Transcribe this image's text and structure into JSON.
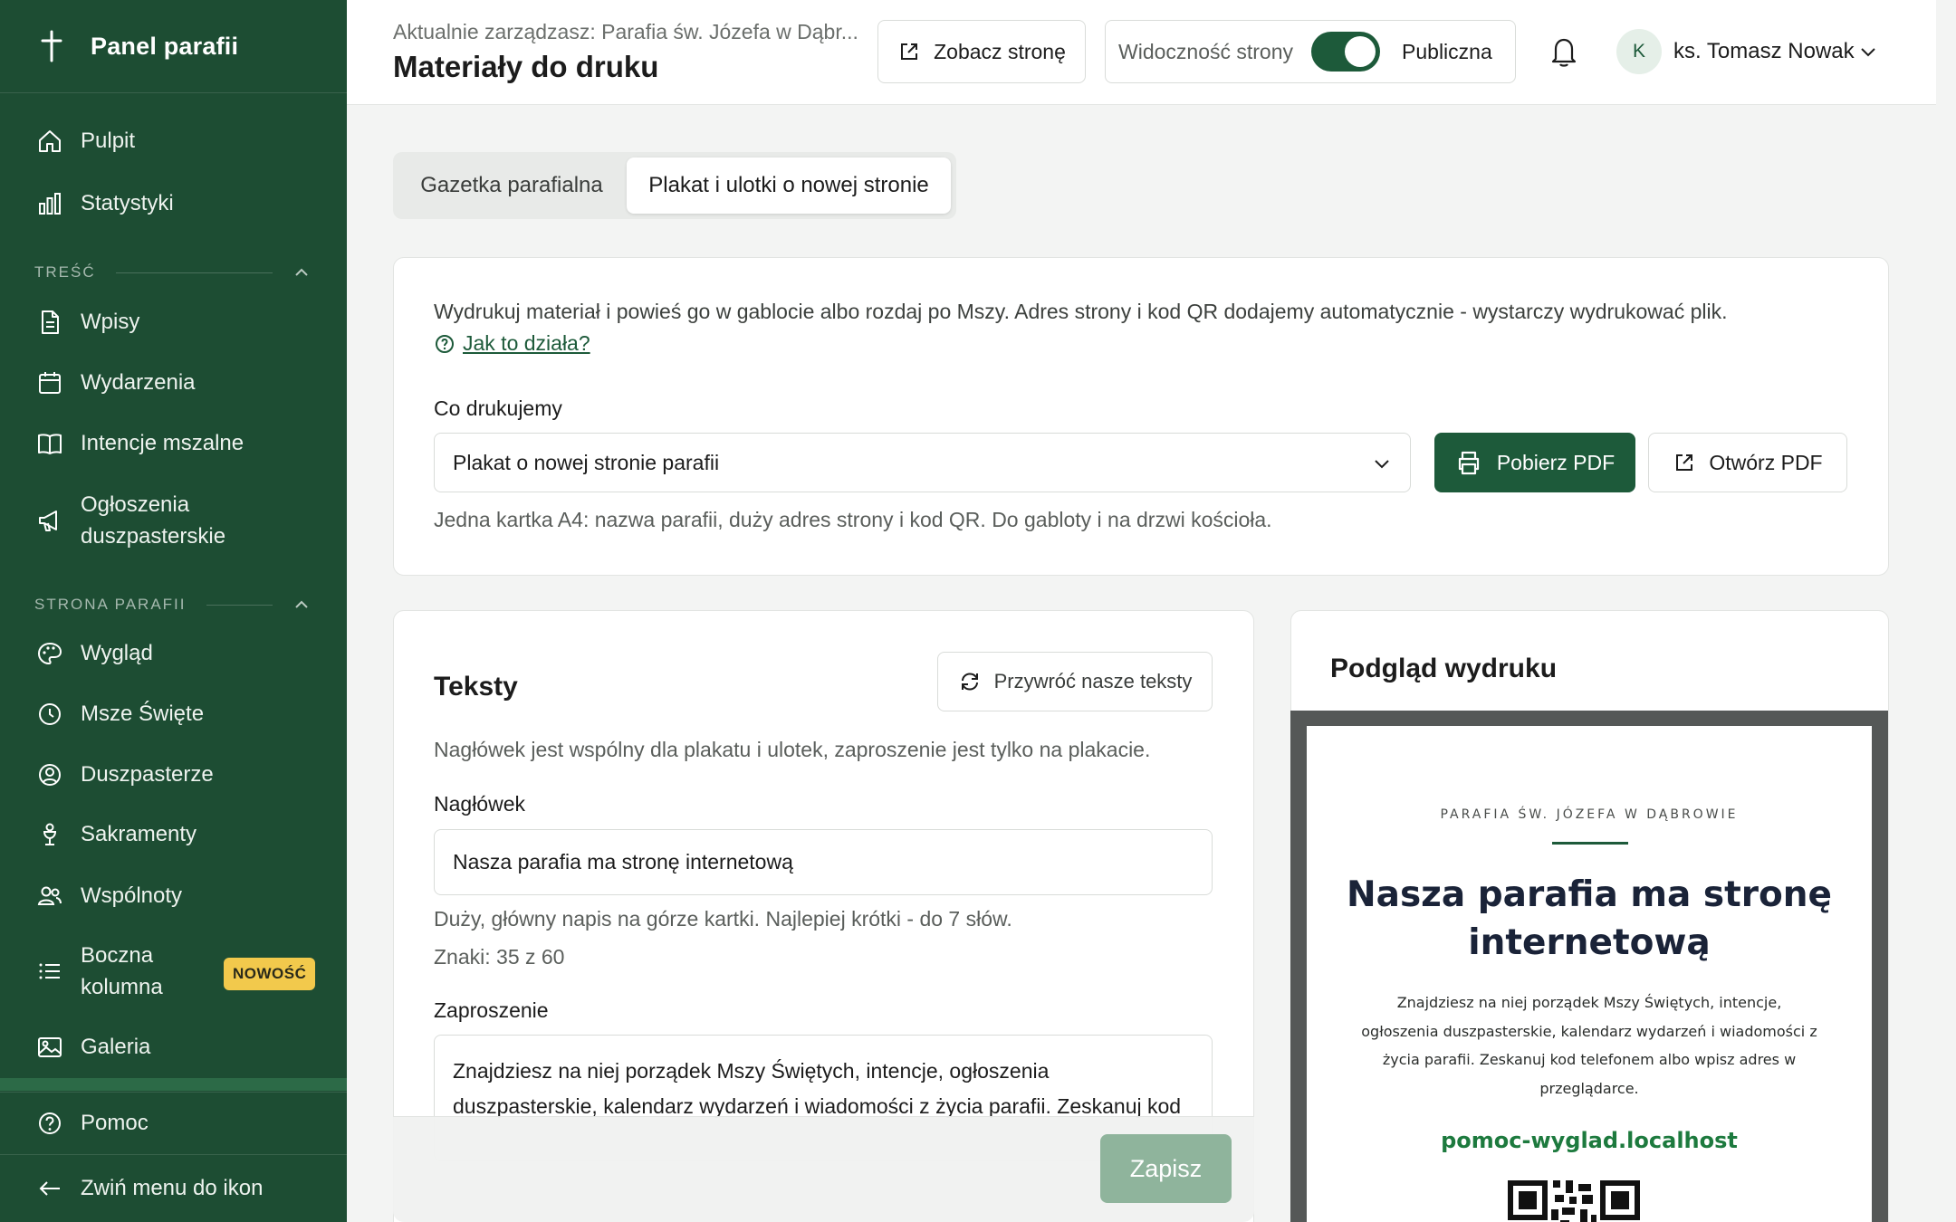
{
  "sidebar": {
    "brand": "Panel parafii",
    "items": [
      {
        "label": "Pulpit"
      },
      {
        "label": "Statystyki"
      },
      {
        "label": "Wpisy"
      },
      {
        "label": "Wydarzenia"
      },
      {
        "label": "Intencje mszalne"
      },
      {
        "label": "Ogłoszenia duszpasterskie"
      },
      {
        "label": "Wygląd"
      },
      {
        "label": "Msze Święte"
      },
      {
        "label": "Duszpasterze"
      },
      {
        "label": "Sakramenty"
      },
      {
        "label": "Wspólnoty"
      },
      {
        "label": "Boczna kolumna",
        "badge": "NOWOŚĆ"
      },
      {
        "label": "Galeria"
      }
    ],
    "sections": [
      "TREŚĆ",
      "STRONA PARAFII"
    ],
    "help": "Pomoc",
    "collapse": "Zwiń menu do ikon"
  },
  "header": {
    "managing": "Aktualnie zarządzasz: Parafia św. Józefa w Dąbr...",
    "title": "Materiały do druku",
    "view_site": "Zobacz stronę",
    "visibility_label": "Widoczność strony",
    "visibility_value": "Publiczna",
    "avatar_letter": "K",
    "user_name": "ks. Tomasz Nowak"
  },
  "tabs": [
    {
      "label": "Gazetka parafialna",
      "active": false
    },
    {
      "label": "Plakat i ulotki o nowej stronie",
      "active": true
    }
  ],
  "print": {
    "intro": "Wydrukuj materiał i powieś go w gablocie albo rozdaj po Mszy. Adres strony i kod QR dodajemy automatycznie - wystarczy wydrukować plik.",
    "help_link": "Jak to działa?",
    "select_label": "Co drukujemy",
    "select_value": "Plakat o nowej stronie parafii",
    "download": "Pobierz PDF",
    "open": "Otwórz PDF",
    "description": "Jedna kartka A4: nazwa parafii, duży adres strony i kod QR. Do gabloty i na drzwi kościoła."
  },
  "texts": {
    "title": "Teksty",
    "restore": "Przywróć nasze teksty",
    "hint": "Nagłówek jest wspólny dla plakatu i ulotek, zaproszenie jest tylko na plakacie.",
    "heading_label": "Nagłówek",
    "heading_value": "Nasza parafia ma stronę internetową",
    "heading_hint": "Duży, główny napis na górze kartki. Najlepiej krótki - do 7 słów.",
    "heading_count": "Znaki: 35 z 60",
    "invite_label": "Zaproszenie",
    "invite_value": "Znajdziesz na niej porządek Mszy Świętych, intencje, ogłoszenia duszpasterskie, kalendarz wydarzeń i wiadomości z życia parafii. Zeskanuj kod",
    "save": "Zapisz"
  },
  "preview": {
    "title": "Podgląd wydruku",
    "kicker": "PARAFIA ŚW. JÓZEFA W DĄBROWIE",
    "headline": "Nasza parafia ma stronę internetową",
    "body": "Znajdziesz na niej porządek Mszy Świętych, intencje, ogłoszenia duszpasterskie, kalendarz wydarzeń i wiadomości z życia parafii. Zeskanuj kod telefonem albo wpisz adres w przeglądarce.",
    "url": "pomoc-wyglad.localhost"
  },
  "colors": {
    "sidebar": "#1d4d33",
    "primary": "#1d5a3a",
    "badge": "#f2c94c"
  }
}
